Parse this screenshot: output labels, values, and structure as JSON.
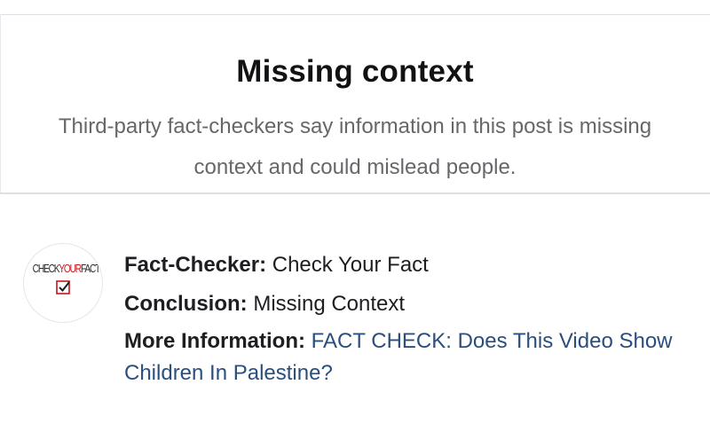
{
  "notice": {
    "title": "Missing context",
    "subtitle": "Third-party fact-checkers say information in this post is missing context and could mislead people."
  },
  "fact_check": {
    "logo_text_prefix": "CHECK",
    "logo_text_accent": "YOUR",
    "logo_text_suffix": "FACT",
    "logo_icon": "checkbox-icon",
    "checker_label": "Fact-Checker:",
    "checker_value": "Check Your Fact",
    "conclusion_label": "Conclusion:",
    "conclusion_value": "Missing Context",
    "more_label": "More Information:",
    "more_link": "FACT CHECK: Does This Video Show Children In Palestine?"
  },
  "colors": {
    "link": "#2a4f7f",
    "logo_accent": "#c4161c",
    "subtitle": "#65676b"
  }
}
